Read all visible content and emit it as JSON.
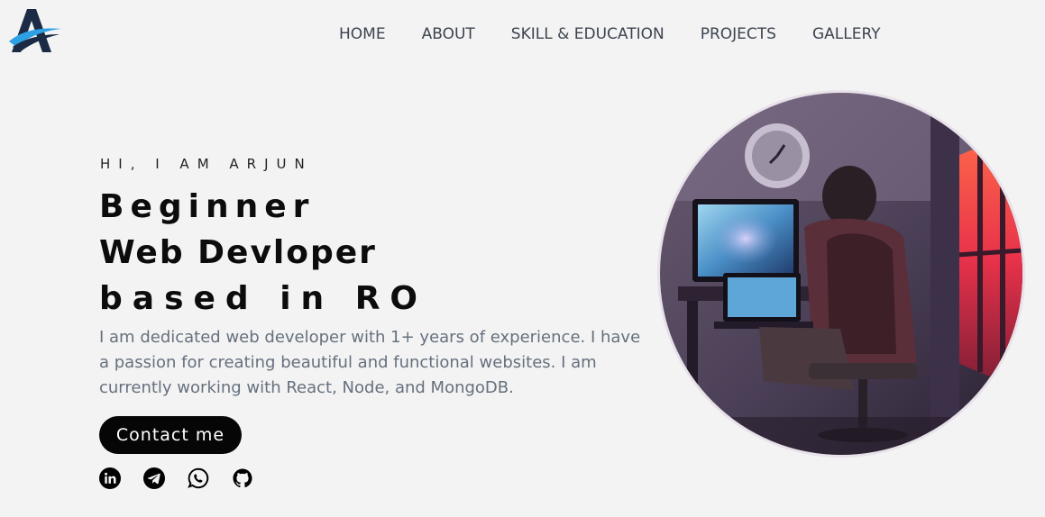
{
  "nav": {
    "items": [
      "HOME",
      "ABOUT",
      "SKILL & EDUCATION",
      "PROJECTS",
      "GALLERY"
    ]
  },
  "hero": {
    "greeting": "HI, I AM ARJUN",
    "headline_line1": "Beginner",
    "headline_line2": "Web Devloper",
    "headline_line3": "based in RO",
    "bio": "I am dedicated web developer with 1+ years of experience. I have a passion for creating beautiful and functional websites. I am currently working with React, Node, and MongoDB.",
    "contact_label": "Contact me"
  },
  "socials": [
    "linkedin-icon",
    "telegram-icon",
    "whatsapp-icon",
    "github-icon"
  ],
  "colors": {
    "background": "#f3f3f3",
    "nav_text": "#3c4350",
    "bio_text": "#66707e",
    "button_bg": "#060606",
    "logo_dark": "#1b2b45",
    "logo_accent": "#2ea1e6"
  }
}
